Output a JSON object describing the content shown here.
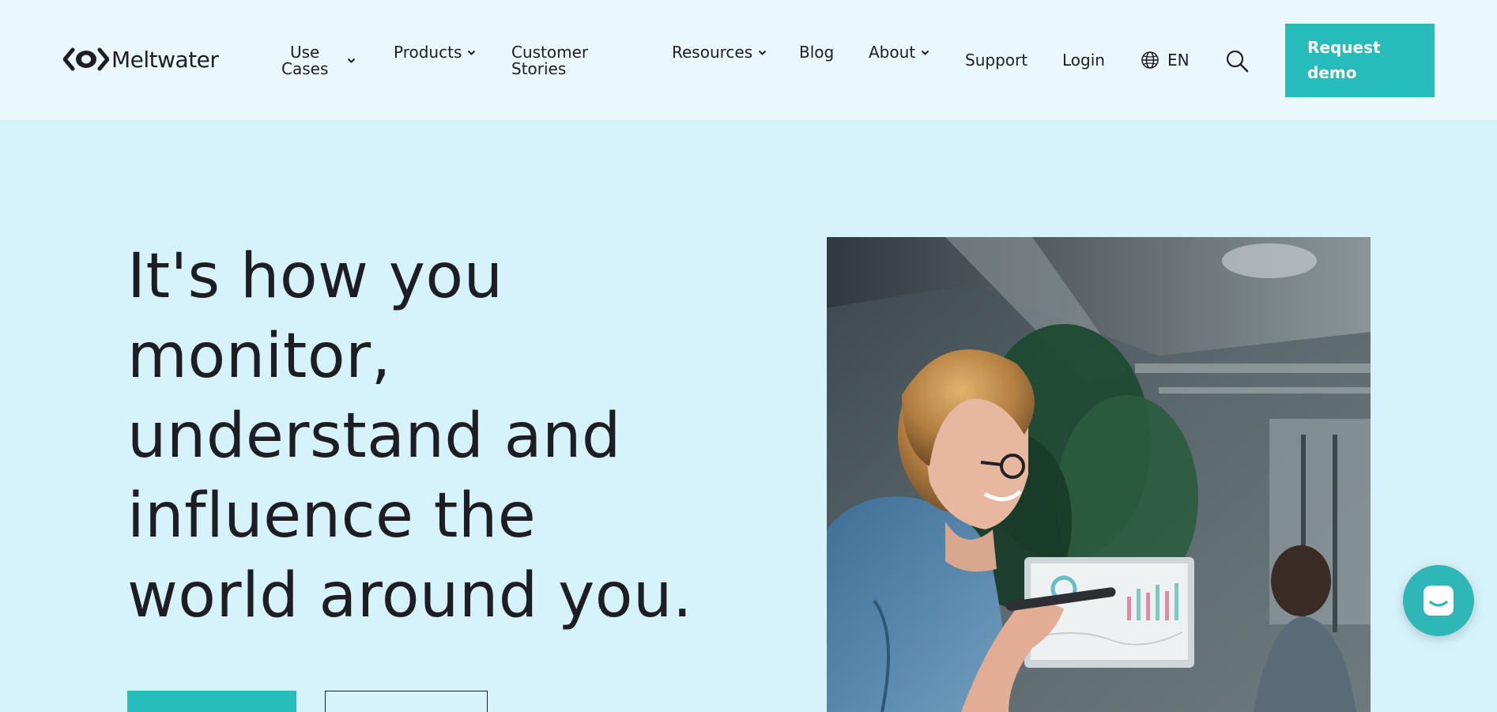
{
  "brand": {
    "name": "Meltwater",
    "accent": "#26bcbc",
    "background": "#d6f3fc",
    "header_bg": "#eaf8fe"
  },
  "nav": {
    "use_cases": {
      "line1": "Use",
      "line2": "Cases",
      "icon": "chevron-down-icon"
    },
    "products": {
      "label": "Products",
      "icon": "chevron-down-icon"
    },
    "customer_stories": {
      "line1": "Customer",
      "line2": "Stories"
    },
    "resources": {
      "label": "Resources",
      "icon": "chevron-down-icon"
    },
    "blog": {
      "label": "Blog"
    },
    "about": {
      "label": "About",
      "icon": "chevron-down-icon"
    },
    "support": {
      "label": "Support"
    },
    "login": {
      "label": "Login"
    },
    "language": {
      "label": "EN",
      "icon": "globe-icon"
    },
    "search": {
      "icon": "search-icon"
    },
    "cta": {
      "line1": "Request",
      "line2": "demo"
    }
  },
  "hero": {
    "title_lines": [
      "It's how you",
      "monitor,",
      "understand and",
      "influence the",
      "world around you."
    ],
    "image_alt": "Smiling woman with glasses holding a phone in an office"
  },
  "chat": {
    "icon": "chat-icon"
  }
}
